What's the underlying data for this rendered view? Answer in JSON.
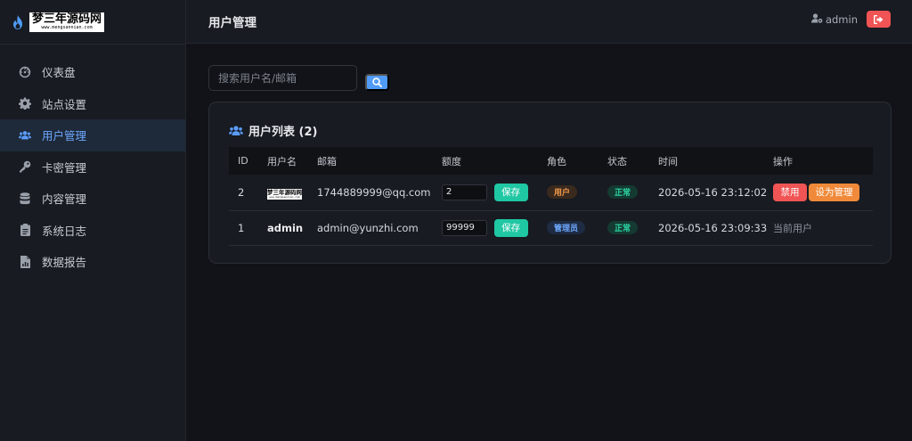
{
  "brand": {
    "logo_text": "梦三年源码网",
    "logo_url": "www.mengsannian.com"
  },
  "sidebar": {
    "items": [
      {
        "label": "仪表盘",
        "icon": "dashboard-icon"
      },
      {
        "label": "站点设置",
        "icon": "gear-icon"
      },
      {
        "label": "用户管理",
        "icon": "users-icon",
        "active": true
      },
      {
        "label": "卡密管理",
        "icon": "key-icon"
      },
      {
        "label": "内容管理",
        "icon": "database-icon"
      },
      {
        "label": "系统日志",
        "icon": "clipboard-icon"
      },
      {
        "label": "数据报告",
        "icon": "file-chart-icon"
      }
    ]
  },
  "header": {
    "title": "用户管理",
    "username": "admin"
  },
  "search": {
    "placeholder": "搜索用户名/邮箱",
    "value": ""
  },
  "card": {
    "title": "用户列表 (2)"
  },
  "table": {
    "columns": [
      "ID",
      "用户名",
      "邮箱",
      "额度",
      "角色",
      "状态",
      "时间",
      "操作"
    ],
    "rows": [
      {
        "id": "2",
        "username_logo_text": "梦三年源码网",
        "username_logo_url": "www.mengsannian.com",
        "email": "1744889999@qq.com",
        "quota": "2",
        "save_label": "保存",
        "role": "用户",
        "status": "正常",
        "time": "2026-05-16 23:12:02",
        "action_ban": "禁用",
        "action_make_admin": "设为管理"
      },
      {
        "id": "1",
        "username": "admin",
        "email": "admin@yunzhi.com",
        "quota": "99999",
        "save_label": "保存",
        "role": "管理员",
        "status": "正常",
        "time": "2026-05-16 23:09:33",
        "action_note": "当前用户"
      }
    ]
  },
  "colors": {
    "accent": "#4f9bf7",
    "save": "#1fc7a3",
    "danger": "#f05454",
    "warning": "#f08a3a",
    "background": "#111318",
    "panel": "#181b21"
  }
}
